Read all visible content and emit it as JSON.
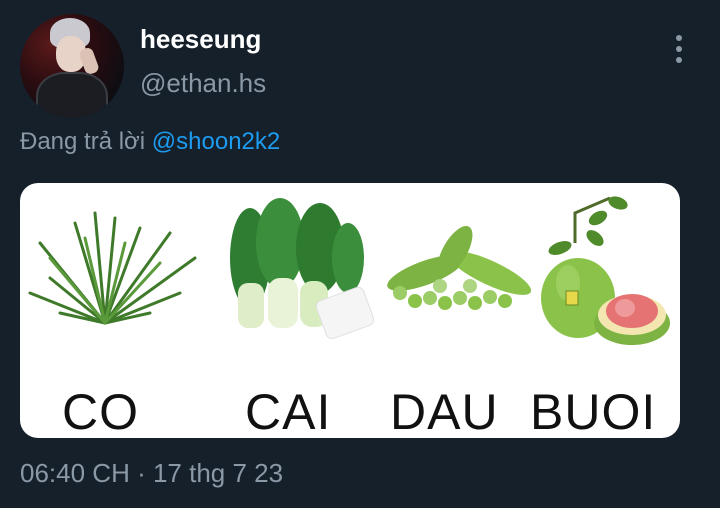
{
  "author": {
    "display_name": "heeseung",
    "handle": "@ethan.hs"
  },
  "menu_icon": "more-vertical-icon",
  "reply": {
    "prefix": "Đang trả lời",
    "mention": "@shoon2k2"
  },
  "image_labels": {
    "grass": "CO",
    "bok_choy": "CAI",
    "edamame": "DAU",
    "pomelo": "BUOI"
  },
  "timestamp": "06:40 CH · 17 thg 7 23",
  "colors": {
    "background": "#15202b",
    "muted": "#8b98a5",
    "link": "#1d9bf0"
  }
}
